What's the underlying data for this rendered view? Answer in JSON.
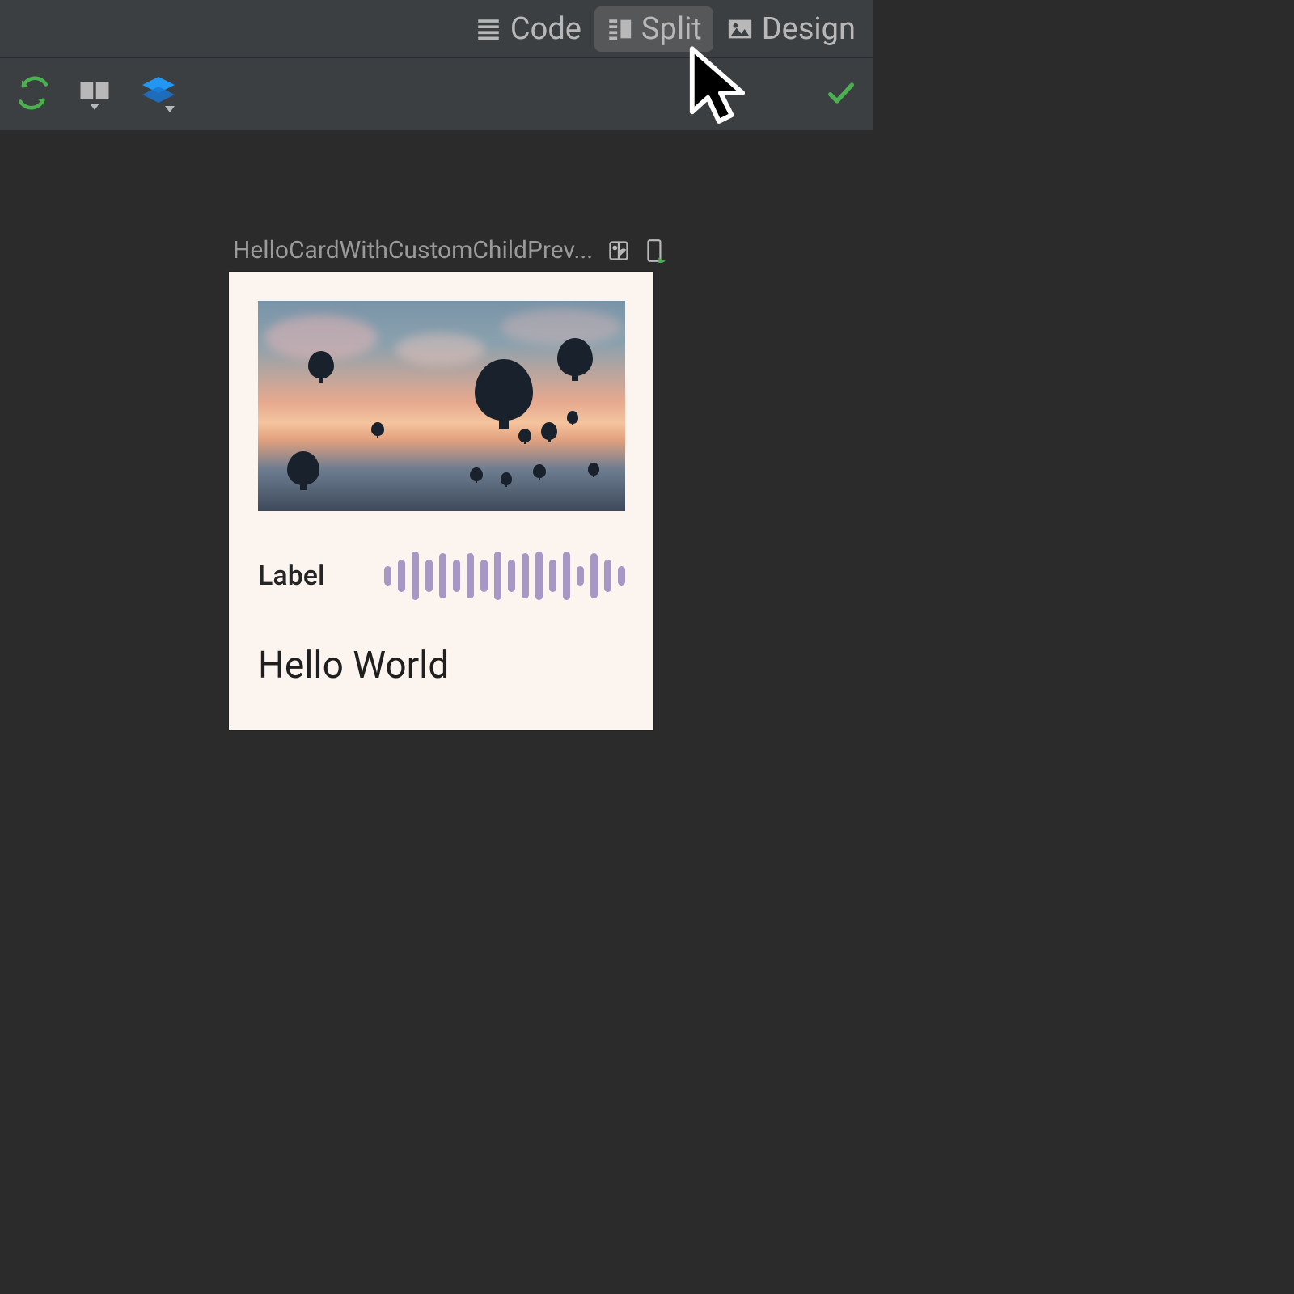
{
  "tabs": {
    "code": "Code",
    "split": "Split",
    "design": "Design",
    "active": "split"
  },
  "preview": {
    "name": "HelloCardWithCustomChildPrev...",
    "card": {
      "label": "Label",
      "title": "Hello World"
    }
  },
  "waveform_heights": [
    24,
    40,
    60,
    40,
    56,
    40,
    56,
    40,
    60,
    40,
    56,
    60,
    40,
    60,
    24,
    56,
    40,
    24
  ],
  "colors": {
    "accent_green": "#4caf50",
    "stack_blue": "#2196f3",
    "wave": "#a697c5"
  }
}
